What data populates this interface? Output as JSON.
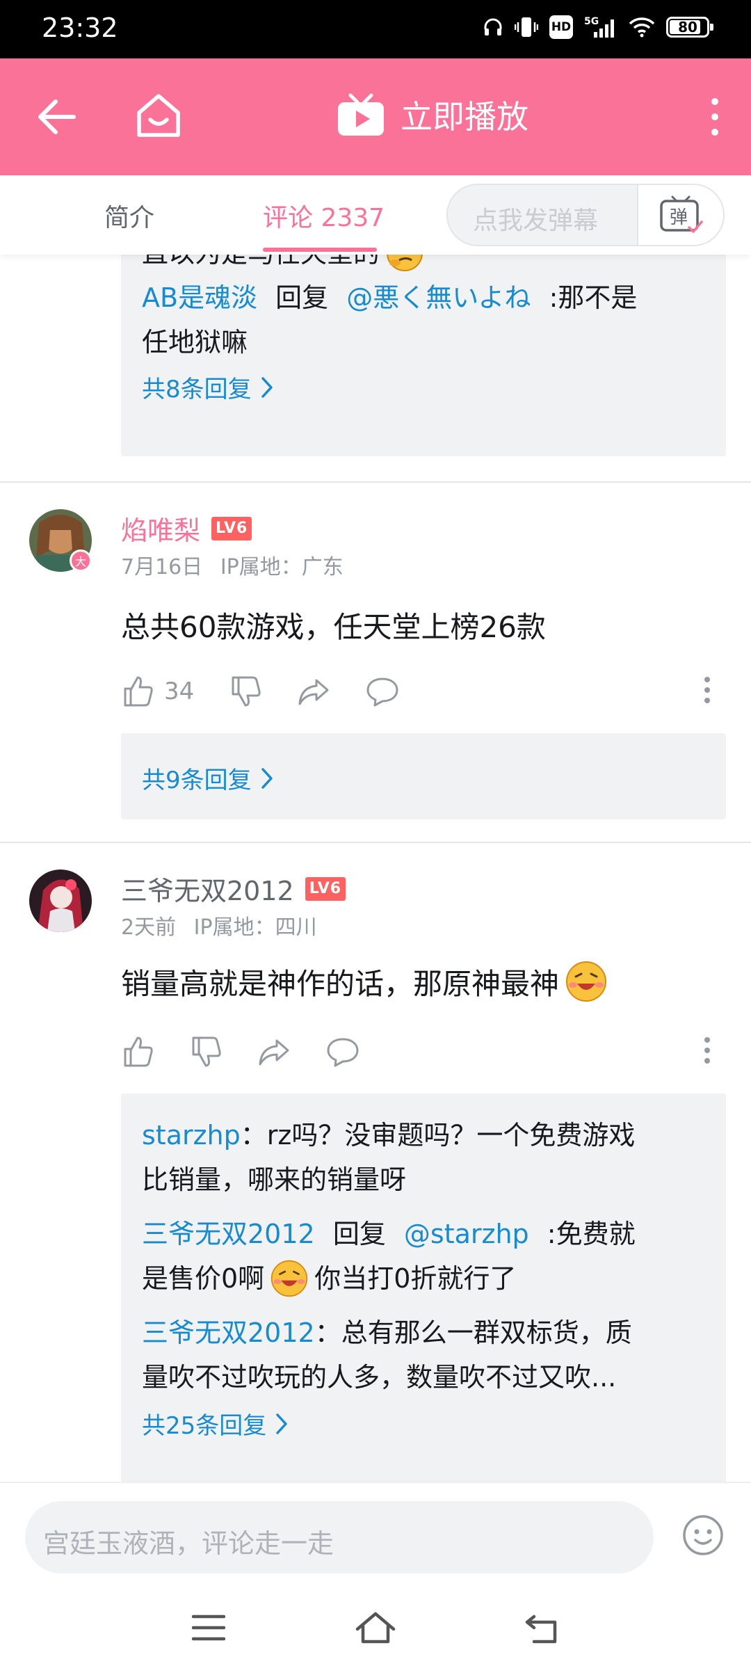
{
  "status_bar": {
    "time": "23:32",
    "network": "5G",
    "hd_label": "HD",
    "battery": "80"
  },
  "header": {
    "play_label": "立即播放"
  },
  "tabs": {
    "intro": "简介",
    "comments": "评论 2337",
    "danmaku_placeholder": "点我发弹幕",
    "danmaku_icon_char": "弹"
  },
  "comment0": {
    "partial_text": "直以为是马任天堂的",
    "replies": [
      {
        "user": "AB是魂淡",
        "mid": "回复",
        "target": "@悪く無いよね",
        "text": ":那不是",
        "text2": "任地狱嘛"
      }
    ],
    "more": "共8条回复"
  },
  "comment1": {
    "username": "焰唯梨",
    "level": "LV6",
    "vip_badge": "大",
    "date": "7月16日",
    "ip": "IP属地：广东",
    "text": "总共60款游戏，任天堂上榜26款",
    "likes": "34",
    "more": "共9条回复"
  },
  "comment2": {
    "username": "三爷无双2012",
    "level": "LV6",
    "date": "2天前",
    "ip": "IP属地：四川",
    "text": "销量高就是神作的话，那原神最神",
    "replies": {
      "r1": {
        "user": "starzhp",
        "text": "：rz吗？没审题吗？一个免费游戏",
        "text2": "比销量，哪来的销量呀"
      },
      "r2": {
        "user": "三爷无双2012",
        "mid": "回复",
        "target": "@starzhp",
        "text": ":免费就",
        "text2a": "是售价0啊",
        "text2b": "你当打0折就行了"
      },
      "r3": {
        "user": "三爷无双2012",
        "text": "：总有那么一群双标货，质",
        "text2": "量吹不过吹玩的人多，数量吹不过又吹..."
      }
    },
    "more": "共25条回复"
  },
  "bottom": {
    "input_placeholder": "宫廷玉液酒，评论走一走"
  },
  "colors": {
    "brand_pink": "#fb7299",
    "link_blue": "#178bcf",
    "level_red": "#ff6161",
    "meta_gray": "#9499a0"
  }
}
